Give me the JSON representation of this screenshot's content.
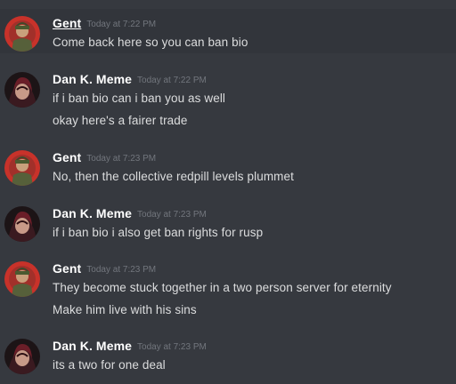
{
  "messages": [
    {
      "author": "Gent",
      "timestamp": "Today at 7:22 PM",
      "avatar": "gent-avatar-icon",
      "lines": [
        "Come back here so you can ban bio"
      ]
    },
    {
      "author": "Dan K. Meme",
      "timestamp": "Today at 7:22 PM",
      "avatar": "dan-avatar-icon",
      "lines": [
        "if i ban bio can i ban you as well",
        "okay here's a fairer trade"
      ]
    },
    {
      "author": "Gent",
      "timestamp": "Today at 7:23 PM",
      "avatar": "gent-avatar-icon",
      "lines": [
        "No, then the collective redpill levels plummet"
      ]
    },
    {
      "author": "Dan K. Meme",
      "timestamp": "Today at 7:23 PM",
      "avatar": "dan-avatar-icon",
      "lines": [
        "if i ban bio i also get ban rights for rusp"
      ]
    },
    {
      "author": "Gent",
      "timestamp": "Today at 7:23 PM",
      "avatar": "gent-avatar-icon",
      "lines": [
        "They become stuck together in a two person server for eternity",
        "Make him live with his sins"
      ]
    },
    {
      "author": "Dan K. Meme",
      "timestamp": "Today at 7:23 PM",
      "avatar": "dan-avatar-icon",
      "lines": [
        "its a two for one deal"
      ]
    }
  ],
  "colors": {
    "background": "#36393f",
    "author": "#ffffff",
    "timestamp": "#72767d",
    "text": "#dcddde"
  }
}
